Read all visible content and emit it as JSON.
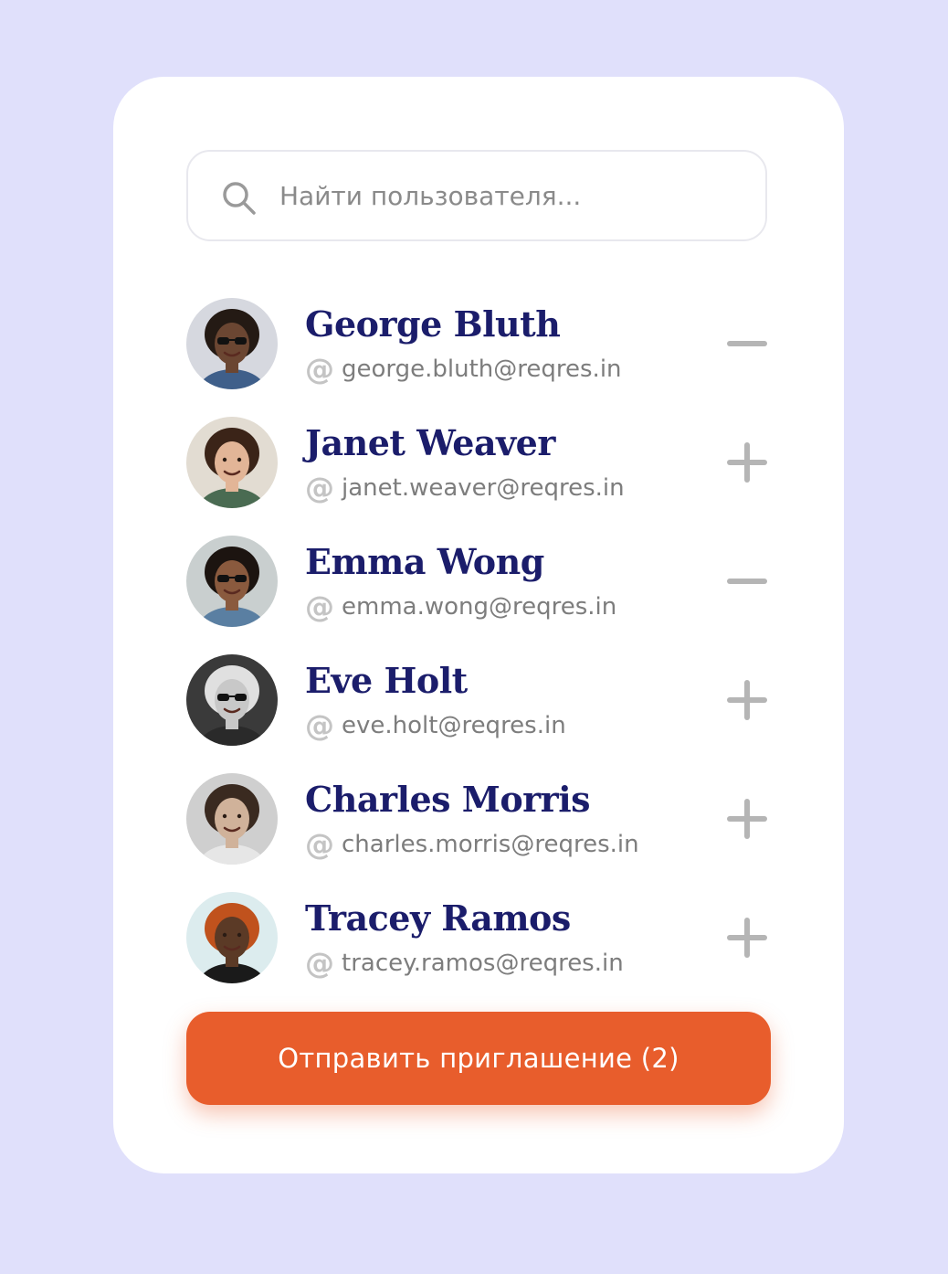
{
  "search": {
    "placeholder": "Найти пользователя...",
    "icon": "search-icon"
  },
  "users": [
    {
      "name": "George Bluth",
      "email": "george.bluth@reqres.in",
      "selected": true,
      "bg": "#d6d8df",
      "skin": "#6b4632",
      "hair": "#241a14",
      "shirt": "#3f5f8a",
      "glasses": true
    },
    {
      "name": "Janet Weaver",
      "email": "janet.weaver@reqres.in",
      "selected": false,
      "bg": "#e2dcd2",
      "skin": "#e2b597",
      "hair": "#3b2418",
      "shirt": "#4a6b52",
      "glasses": false
    },
    {
      "name": "Emma Wong",
      "email": "emma.wong@reqres.in",
      "selected": true,
      "bg": "#c9cfcf",
      "skin": "#8a5a3e",
      "hair": "#1c1410",
      "shirt": "#5a7fa2",
      "glasses": true
    },
    {
      "name": "Eve Holt",
      "email": "eve.holt@reqres.in",
      "selected": false,
      "bg": "#3a3a3a",
      "skin": "#c8c8c8",
      "hair": "#e0e0e0",
      "shirt": "#2a2a2a",
      "glasses": true
    },
    {
      "name": "Charles Morris",
      "email": "charles.morris@reqres.in",
      "selected": false,
      "bg": "#cfcfcf",
      "skin": "#d0b29a",
      "hair": "#3a2a20",
      "shirt": "#e6e6e6",
      "glasses": false
    },
    {
      "name": "Tracey Ramos",
      "email": "tracey.ramos@reqres.in",
      "selected": false,
      "bg": "#dcecee",
      "skin": "#5b3a26",
      "hair": "#c0521d",
      "shirt": "#1a1a1a",
      "glasses": false
    }
  ],
  "send_button": {
    "label": "Отправить приглашение (2)"
  },
  "colors": {
    "background": "#e0e0fb",
    "card": "#ffffff",
    "name": "#1b1d6b",
    "accent": "#e85d2c",
    "icon_grey": "#b5b5b5"
  }
}
